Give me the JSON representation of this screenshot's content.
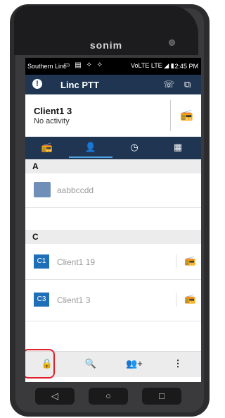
{
  "device": {
    "brand": "sonim"
  },
  "status_bar": {
    "carrier": "Southern Linc",
    "left_icons": "▭ ▤ ✧ ✧",
    "right_icons": "VoLTE LTE ◢ ▮",
    "time": "12:45 PM"
  },
  "app_bar": {
    "title": "Linc PTT",
    "info_icon": "!",
    "call_icon": "☏",
    "window_icon": "⧉"
  },
  "active_contact": {
    "name": "Client1 3",
    "status": "No activity",
    "ptt_icon": "📻"
  },
  "tabs": [
    {
      "name": "ptt-radio",
      "icon": "📻"
    },
    {
      "name": "contacts",
      "icon": "👤"
    },
    {
      "name": "history",
      "icon": "◷"
    },
    {
      "name": "dialpad",
      "icon": "▦"
    }
  ],
  "sections": [
    {
      "letter": "A"
    },
    {
      "letter": "C"
    }
  ],
  "contacts": [
    {
      "avatar": "",
      "label": "aabbccdd"
    },
    {
      "avatar": "C1",
      "label": "Client1 19"
    },
    {
      "avatar": "C3",
      "label": "Client1 3"
    }
  ],
  "bottom_bar": [
    {
      "name": "lock",
      "icon": "🔒"
    },
    {
      "name": "search",
      "icon": "🔍"
    },
    {
      "name": "add-contact",
      "icon": "👥+"
    },
    {
      "name": "more",
      "icon": "⋮"
    }
  ],
  "nav": [
    {
      "icon": "◁"
    },
    {
      "icon": "○"
    },
    {
      "icon": "□"
    }
  ],
  "colors": {
    "app_bar": "#1f3552",
    "accent": "#4fa3e0",
    "highlight_box": "#e0202c"
  }
}
